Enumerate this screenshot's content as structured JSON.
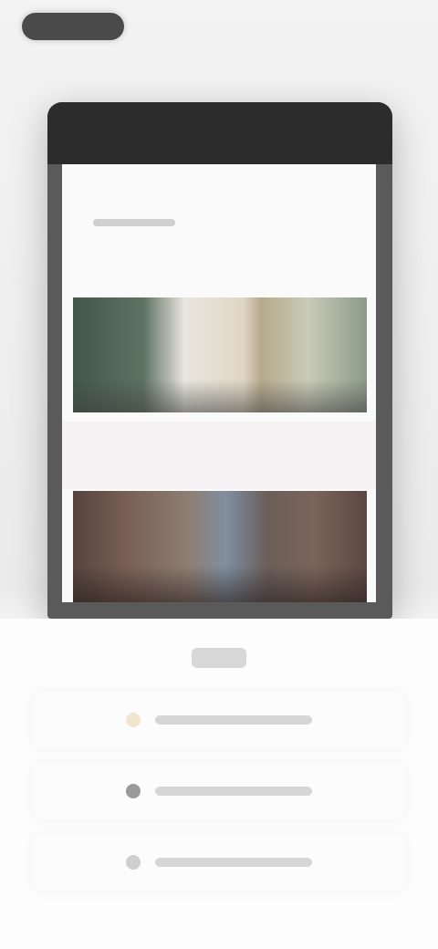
{
  "header": {
    "brand": ""
  },
  "screen": {
    "heading": ""
  },
  "panel": {
    "title": "",
    "options": [
      {
        "label": "",
        "icon": "sun-icon",
        "icon_color": "#f0e6cf"
      },
      {
        "label": "",
        "icon": "moon-icon",
        "icon_color": "#9a9a9a"
      },
      {
        "label": "",
        "icon": "auto-icon",
        "icon_color": "#cfcfcf"
      }
    ]
  }
}
